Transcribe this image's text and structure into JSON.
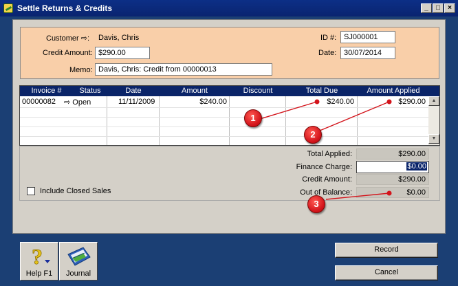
{
  "window": {
    "title": "Settle Returns & Credits"
  },
  "titlebar_controls": {
    "minimize": "_",
    "maximize": "□",
    "close": "×"
  },
  "header": {
    "customer_label": "Customer",
    "customer_value": "Davis, Chris",
    "credit_amount_label": "Credit Amount:",
    "credit_amount_value": "$290.00",
    "memo_label": "Memo:",
    "memo_value": "Davis, Chris:  Credit from 00000013",
    "id_label": "ID #:",
    "id_value": "SJ000001",
    "date_label": "Date:",
    "date_value": "30/07/2014"
  },
  "grid": {
    "columns": [
      "Invoice #",
      "Status",
      "Date",
      "Amount",
      "Discount",
      "Total Due",
      "Amount Applied"
    ],
    "rows": [
      {
        "invoice": "00000082",
        "status": "Open",
        "date": "11/11/2009",
        "amount": "$240.00",
        "discount": "",
        "total_due": "$240.00",
        "amount_applied": "$290.00"
      }
    ]
  },
  "totals": {
    "total_applied_label": "Total Applied:",
    "total_applied_value": "$290.00",
    "finance_charge_label": "Finance Charge:",
    "finance_charge_value": "$0.00",
    "credit_amount_label": "Credit Amount:",
    "credit_amount_value": "$290.00",
    "out_of_balance_label": "Out of Balance:",
    "out_of_balance_value": "$0.00"
  },
  "include_closed": {
    "label": "Include Closed Sales",
    "checked": false
  },
  "toolbar": {
    "help_label": "Help F1",
    "journal_label": "Journal"
  },
  "buttons": {
    "record_label": "Record",
    "cancel_label": "Cancel"
  },
  "callouts": [
    "1",
    "2",
    "3"
  ],
  "colors": {
    "header_panel": "#f9cfa9",
    "grid_header": "#0a2468",
    "callout": "#d3141b",
    "frame": "#1b3f74"
  }
}
